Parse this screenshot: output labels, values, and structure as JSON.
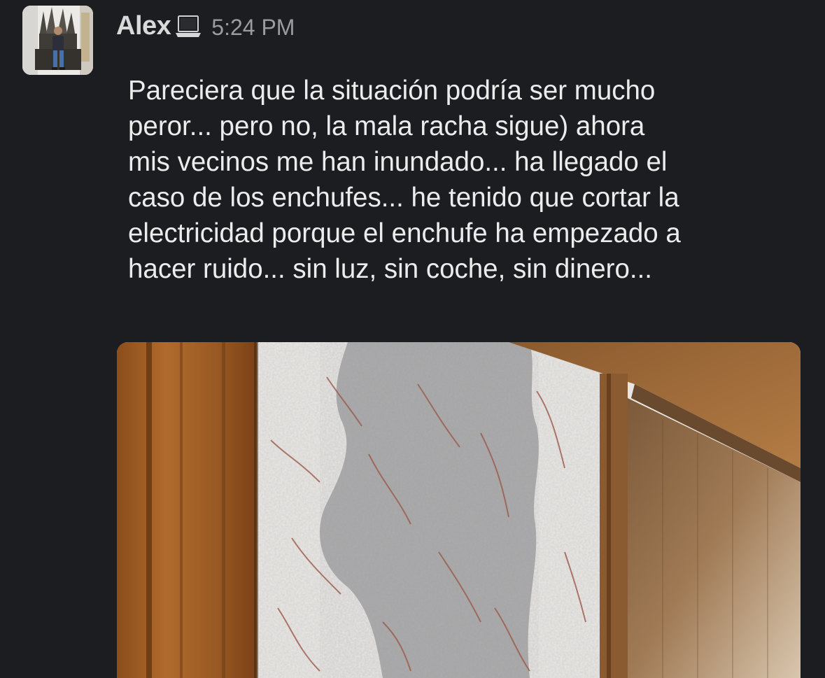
{
  "message": {
    "author": "Alex",
    "status_icon": "laptop-icon",
    "timestamp": "5:24 PM",
    "text": "Pareciera que la situación podría ser mucho\nperor... pero no, la mala racha sigue) ahora\nmis vecinos me han inundado... ha llegado el\ncaso de los enchufes... he tenido que cortar la\nelectricidad porque el enchufe ha empezado a\nhacer ruido... sin luz, sin coche, sin dinero...",
    "avatar_icon": "avatar-throne-photo",
    "attachment_icon": "photo-water-damaged-wall"
  },
  "colors": {
    "background": "#1b1d21",
    "author": "#d9d9d9",
    "timestamp": "#9a9ca0",
    "text": "#ececec"
  }
}
